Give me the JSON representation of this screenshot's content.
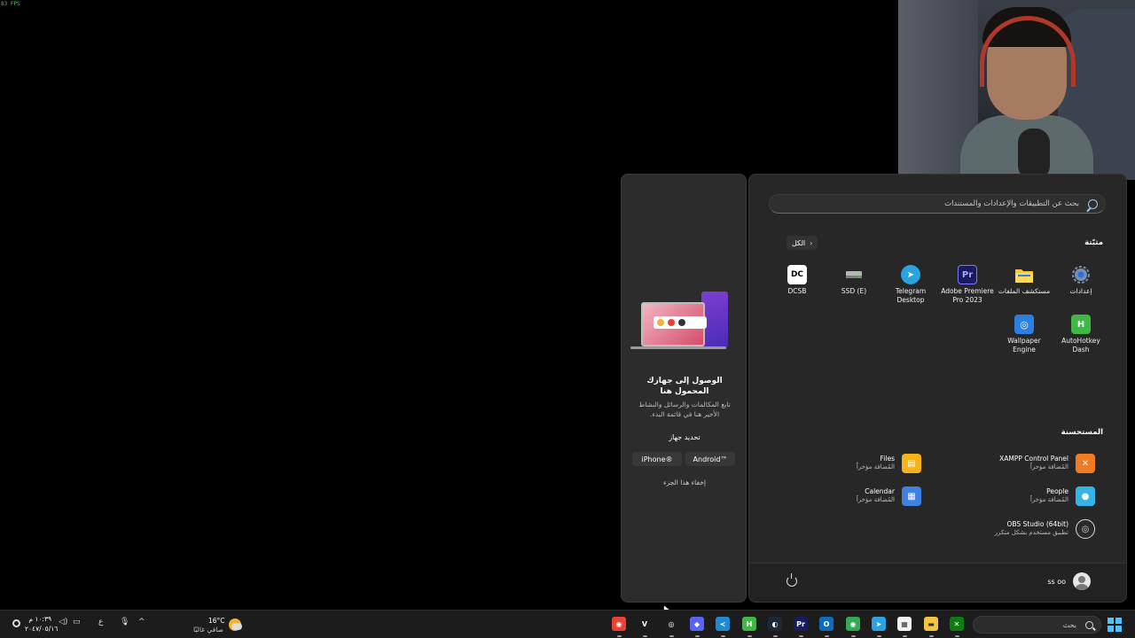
{
  "overlay": {
    "fps": "83 FPS"
  },
  "phone_panel": {
    "title": "الوصول إلى جهازك المحمول هنا",
    "description": "تابع المكالمات والرسائل والنشاط الأخير هنا في قائمة البدء.",
    "choose_device": "تحديد جهاز",
    "iphone_label": "iPhone®",
    "android_label": "Android™",
    "hide_label": "إخفاء هذا الجزء"
  },
  "start_menu": {
    "search_placeholder": "بحث عن التطبيقات والإعدادات والمستندات",
    "pinned_title": "مثبّتة",
    "all_button": "الكل",
    "pinned": [
      {
        "label": "إعدادات",
        "icon": "settings-icon",
        "color": "#5c7bd9"
      },
      {
        "label": "مستكشف الملفات",
        "icon": "folder-icon",
        "color": "#f5c542"
      },
      {
        "label": "Adobe Premiere Pro 2023",
        "icon": "premiere-icon",
        "color": "#1a1a5e",
        "glyph": "Pr"
      },
      {
        "label": "Telegram Desktop",
        "icon": "telegram-icon",
        "color": "#2aa3e0"
      },
      {
        "label": "SSD (E)",
        "icon": "drive-icon",
        "color": "#9a9a9a"
      },
      {
        "label": "DCSB",
        "icon": "dcsb-icon",
        "color": "#ffffff",
        "glyph": "DC"
      },
      {
        "label": "AutoHotkey Dash",
        "icon": "autohotkey-icon",
        "color": "#3fb845",
        "glyph": "H"
      },
      {
        "label": "Wallpaper Engine",
        "icon": "wallpaper-engine-icon",
        "color": "#2b7fe0"
      }
    ],
    "recommended_title": "المستحسنة",
    "recommended": [
      {
        "name": "XAMPP Control Panel",
        "sub": "المُضافة مؤخراً",
        "icon": "xampp-icon",
        "color": "#f07b23"
      },
      {
        "name": "Files",
        "sub": "المُضافة مؤخراً",
        "icon": "files-icon",
        "color": "#f5b21b"
      },
      {
        "name": "People",
        "sub": "المُضافة مؤخراً",
        "icon": "people-icon",
        "color": "#35b5e6"
      },
      {
        "name": "Calendar",
        "sub": "المُضافة مؤخراً",
        "icon": "calendar-icon",
        "color": "#3f82e0"
      },
      {
        "name": "OBS Studio (64bit)",
        "sub": "تطبيق مستخدم بشكل متكرر",
        "icon": "obs-icon",
        "color": "#2a2a2a"
      }
    ],
    "user_name": "ss oo"
  },
  "taskbar": {
    "search_placeholder": "بحث",
    "weather_temp": "16°C",
    "weather_condition": "صافي غالبًا",
    "time": "١٠:٣٩ م",
    "date": "٢٠٤٧/٠٥/١٦",
    "language": "ع",
    "apps": [
      {
        "name": "chrome-icon",
        "color": "#e94235",
        "glyph": "◉"
      },
      {
        "name": "vegas-icon",
        "color": "#1c1c1c",
        "glyph": "V"
      },
      {
        "name": "obs-icon",
        "color": "#1c1c1c",
        "glyph": "◎"
      },
      {
        "name": "discord-icon",
        "color": "#5865f2",
        "glyph": "◆"
      },
      {
        "name": "vscode-icon",
        "color": "#1f8ad2",
        "glyph": "≺"
      },
      {
        "name": "autohotkey-icon",
        "color": "#3fb845",
        "glyph": "H"
      },
      {
        "name": "steam-icon",
        "color": "#1b2838",
        "glyph": "◐"
      },
      {
        "name": "premiere-icon",
        "color": "#1a1a5e",
        "glyph": "Pr"
      },
      {
        "name": "outlook-icon",
        "color": "#0f6cbd",
        "glyph": "O"
      },
      {
        "name": "chrome-icon",
        "color": "#34a853",
        "glyph": "◉"
      },
      {
        "name": "telegram-icon",
        "color": "#2aa3e0",
        "glyph": "➤"
      },
      {
        "name": "store-icon",
        "color": "#f3f3f3",
        "glyph": "▦"
      },
      {
        "name": "file-explorer-icon",
        "color": "#f5c542",
        "glyph": "▬"
      },
      {
        "name": "xbox-icon",
        "color": "#107c10",
        "glyph": "✕"
      }
    ]
  }
}
